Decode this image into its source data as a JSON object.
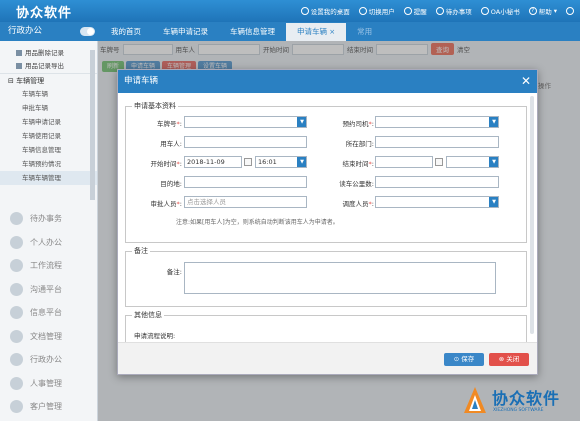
{
  "app": {
    "logo": "协众软件",
    "org_name": "行政办公"
  },
  "header": {
    "items": [
      {
        "icon": "gear-icon",
        "label": "设置我的桌面"
      },
      {
        "icon": "user-switch-icon",
        "label": "切换用户"
      },
      {
        "icon": "bell-icon",
        "label": "提醒"
      },
      {
        "icon": "todo-icon",
        "label": "待办事项"
      },
      {
        "icon": "oa-icon",
        "label": "OA小秘书"
      },
      {
        "icon": "help-icon",
        "label": "帮助"
      },
      {
        "icon": "power-icon",
        "label": ""
      }
    ]
  },
  "tabs": [
    "我的首页",
    "车辆申请记录",
    "车辆信息管理",
    "申请车辆",
    "常用"
  ],
  "sidebar": {
    "sub_items": [
      "用品删除记录",
      "用品记录导出"
    ],
    "group": "车辆管理",
    "items": [
      "车辆车辆",
      "申批车辆",
      "车辆申请记录",
      "车辆使用记录",
      "车辆信息管理",
      "车辆预约情况",
      "车辆车辆管理"
    ],
    "modules": [
      "待办事务",
      "个人办公",
      "工作流程",
      "沟通平台",
      "信息平台",
      "文档管理",
      "行政办公",
      "人事管理",
      "客户管理"
    ]
  },
  "filter": {
    "plate_label": "车牌号",
    "user_label": "用车人",
    "start_label": "开始时间",
    "end_label": "结束时间",
    "search": "查询",
    "clear": "清空"
  },
  "toolbar": [
    "刷新",
    "申请车辆",
    "车辆管理",
    "设置车辆"
  ],
  "grid": {
    "last_col": "操作"
  },
  "dialog": {
    "title": "申请车辆",
    "sections": {
      "basic": "申请基本资料",
      "remark": "备注",
      "other": "其他信息"
    },
    "fields": {
      "plate": {
        "label": "车牌号",
        "value": ""
      },
      "driver": {
        "label": "预约司机",
        "value": ""
      },
      "user": {
        "label": "用车人",
        "value": ""
      },
      "dept": {
        "label": "所在部门",
        "value": ""
      },
      "start": {
        "label": "开始时间",
        "date": "2018-11-09",
        "time": "16:01"
      },
      "end": {
        "label": "结束时间",
        "date": "",
        "time": ""
      },
      "dest": {
        "label": "目的地",
        "value": ""
      },
      "mileage": {
        "label": "读车公里数",
        "value": ""
      },
      "approver": {
        "label": "审批人员",
        "placeholder": "点击选择人员"
      },
      "dispatcher": {
        "label": "调度人员",
        "value": ""
      }
    },
    "note": "注意:如果[用车人]为空，则系统自动判断该用车人为申请者。",
    "remark_label": "备注",
    "flow_label": "申请流程说明:",
    "buttons": {
      "save": "保存",
      "close": "关闭"
    }
  },
  "watermark": {
    "brand": "协众软件",
    "sub": "XIEZHONG SOFTWARE"
  }
}
